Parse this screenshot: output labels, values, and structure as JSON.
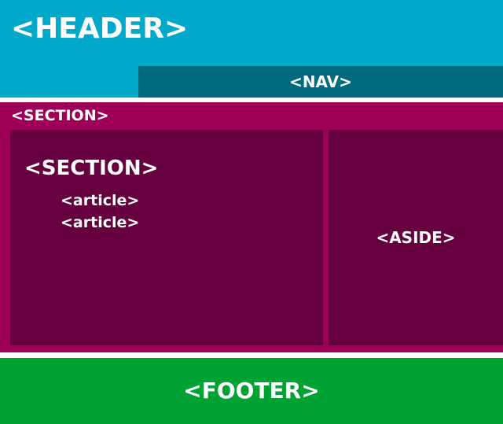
{
  "colors": {
    "header": "#00a9c9",
    "nav": "#006a7e",
    "section_outer": "#9e0057",
    "section_inner": "#67003f",
    "aside": "#67003f",
    "footer": "#00a234",
    "text": "#ffffff"
  },
  "header": {
    "label": "<HEADER>"
  },
  "nav": {
    "label": "<NAV>"
  },
  "section_outer": {
    "label": "<SECTION>"
  },
  "section_inner": {
    "label": "<SECTION>",
    "articles": [
      "<article>",
      "<article>"
    ]
  },
  "aside": {
    "label": "<ASIDE>"
  },
  "footer": {
    "label": "<FOOTER>"
  }
}
